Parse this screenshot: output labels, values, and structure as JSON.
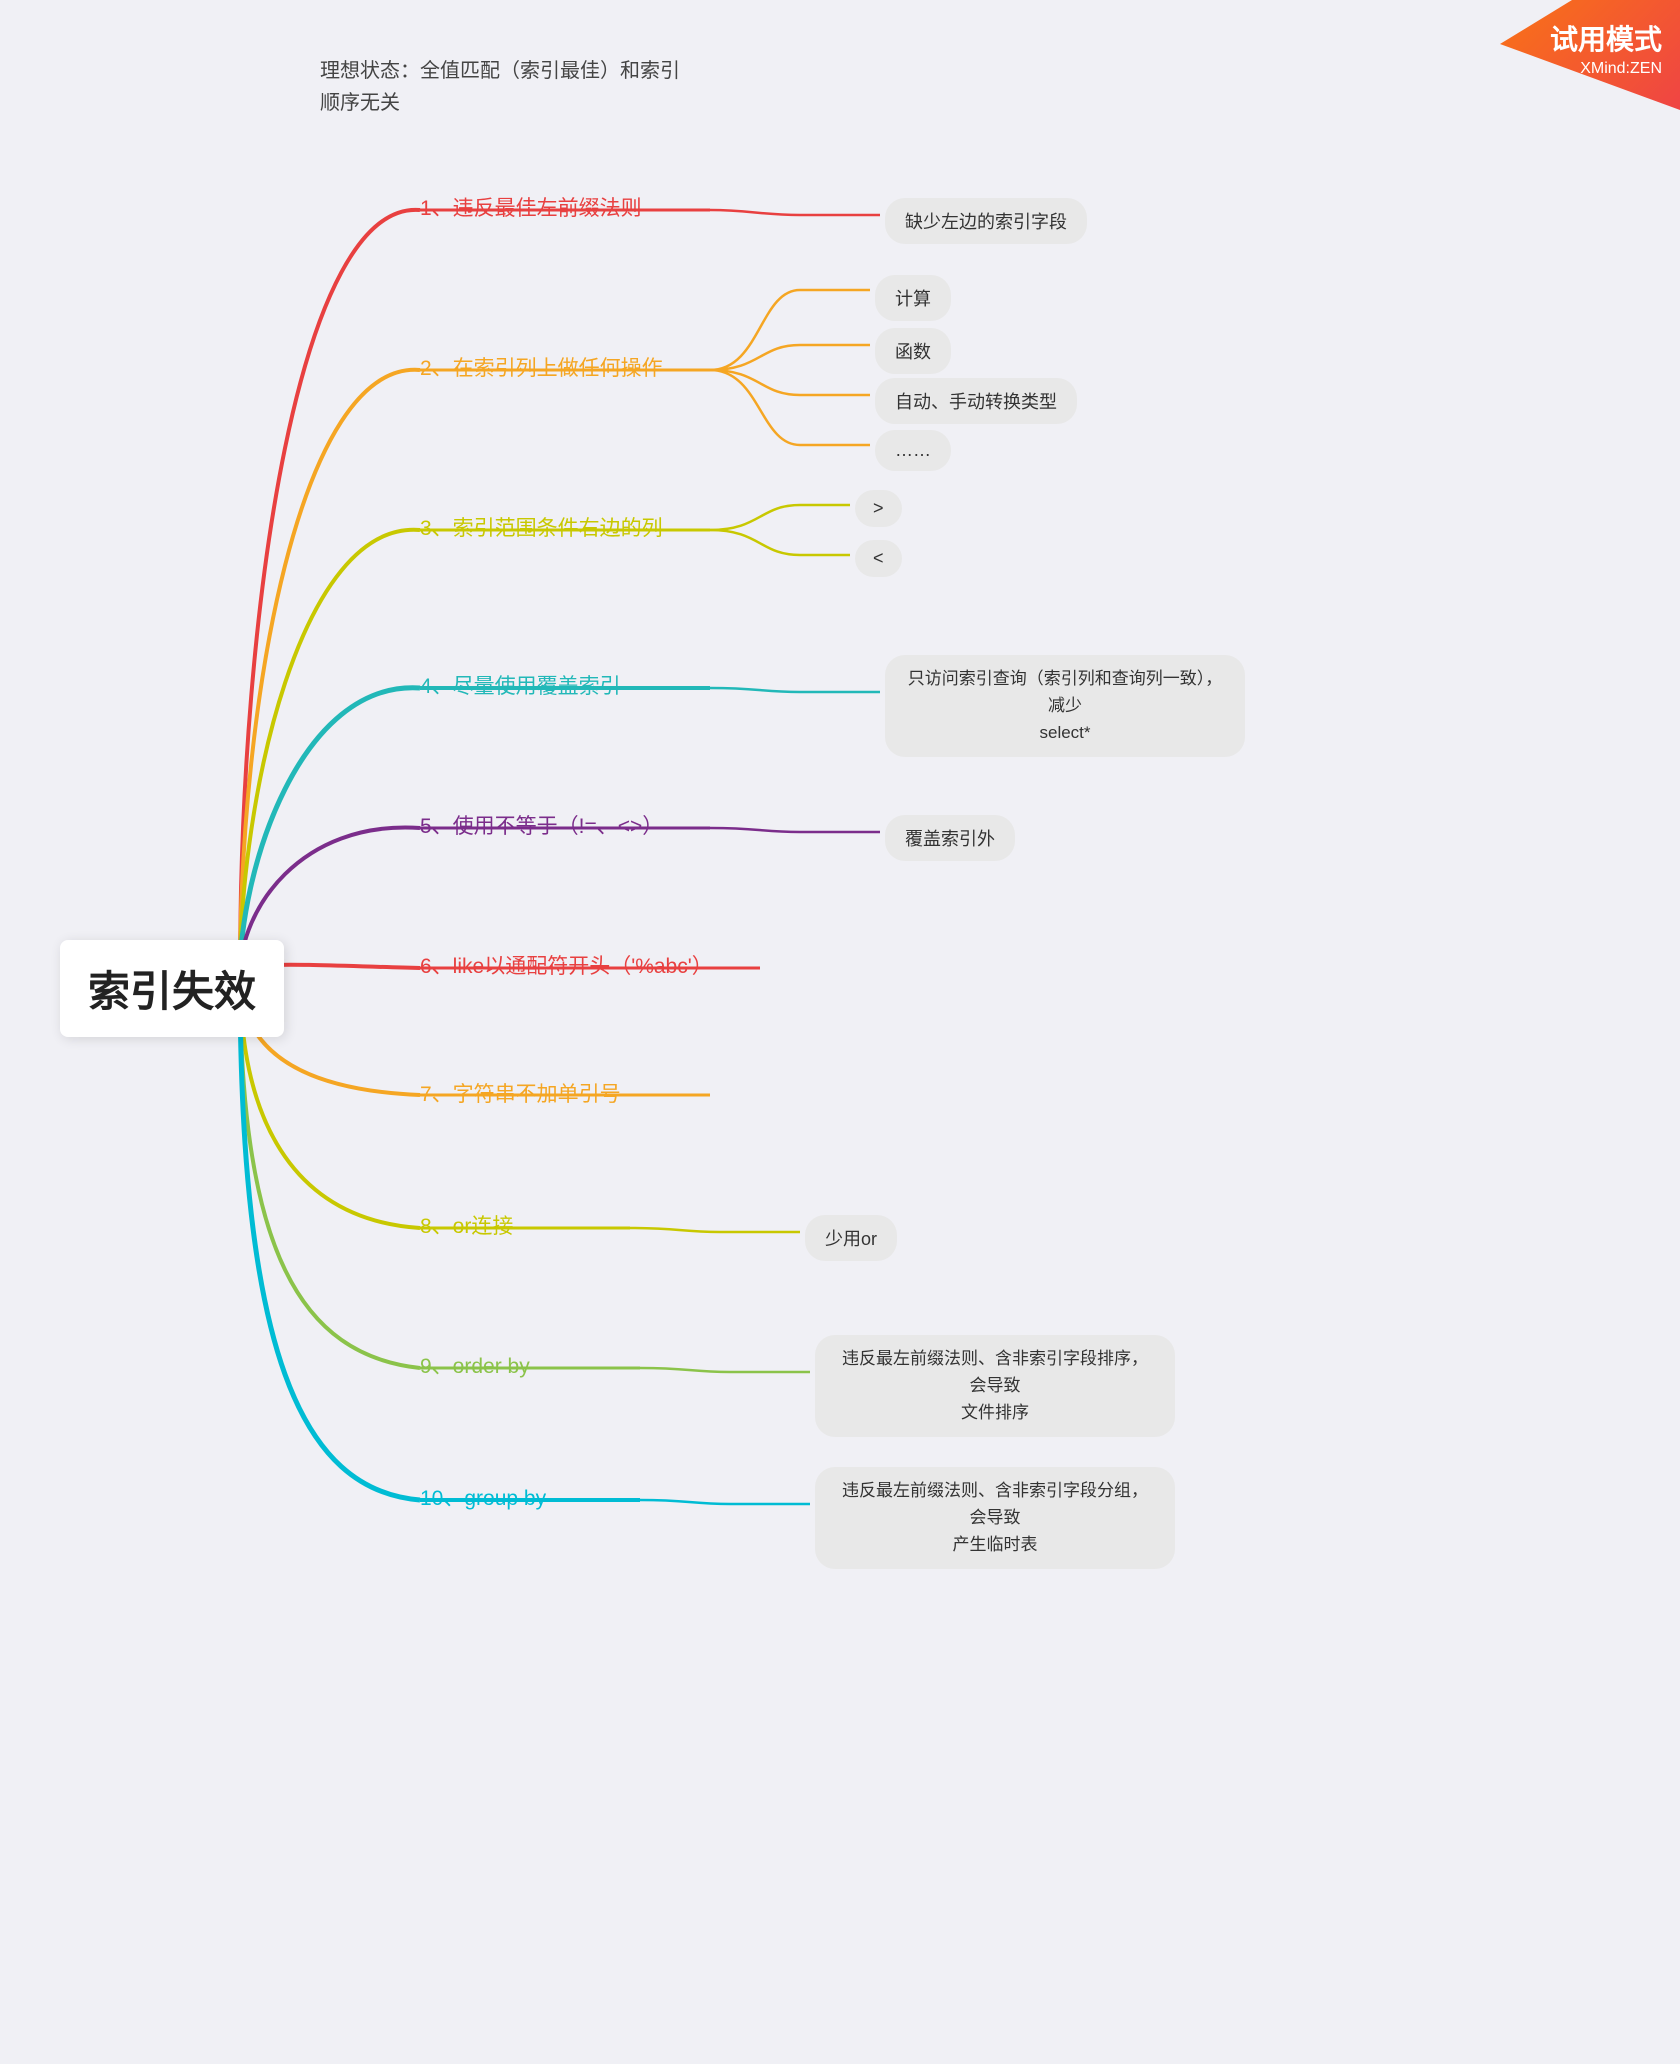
{
  "trial": {
    "text": "试用模式",
    "brand": "XMind:ZEN"
  },
  "topNote": {
    "line1": "理想状态：全值匹配（索引最佳）和索引",
    "line2": "顺序无关"
  },
  "root": {
    "label": "索引失效"
  },
  "branches": [
    {
      "id": "b1",
      "label": "1、违反最佳左前缀法则",
      "color": "#e84040"
    },
    {
      "id": "b2",
      "label": "2、在索引列上做任何操作",
      "color": "#f5a623"
    },
    {
      "id": "b3",
      "label": "3、索引范围条件右边的列",
      "color": "#c8c800"
    },
    {
      "id": "b4",
      "label": "4、尽量使用覆盖索引",
      "color": "#22b8b8"
    },
    {
      "id": "b5",
      "label": "5、使用不等于（!=、<>）",
      "color": "#7b2d8b"
    },
    {
      "id": "b6",
      "label": "6、like以通配符开头（'%abc'）",
      "color": "#e84040"
    },
    {
      "id": "b7",
      "label": "7、字符串不加单引号",
      "color": "#f5a623"
    },
    {
      "id": "b8",
      "label": "8、or连接",
      "color": "#c8c800"
    },
    {
      "id": "b9",
      "label": "9、order by",
      "color": "#8bc34a"
    },
    {
      "id": "b10",
      "label": "10、group by",
      "color": "#00bcd4"
    }
  ],
  "leaves": {
    "b1": [
      "缺少左边的索引字段"
    ],
    "b2": [
      "计算",
      "函数",
      "自动、手动转换类型",
      "……"
    ],
    "b3": [
      ">",
      "<"
    ],
    "b4": [
      "只访问索引查询（索引列和查询列一致），减少\nselect*"
    ],
    "b5": [
      "覆盖索引外"
    ],
    "b8": [
      "少用or"
    ],
    "b9": [
      "违反最左前缀法则、含非索引字段排序，会导致\n文件排序"
    ],
    "b10": [
      "违反最左前缀法则、含非索引字段分组，会导致\n产生临时表"
    ]
  }
}
